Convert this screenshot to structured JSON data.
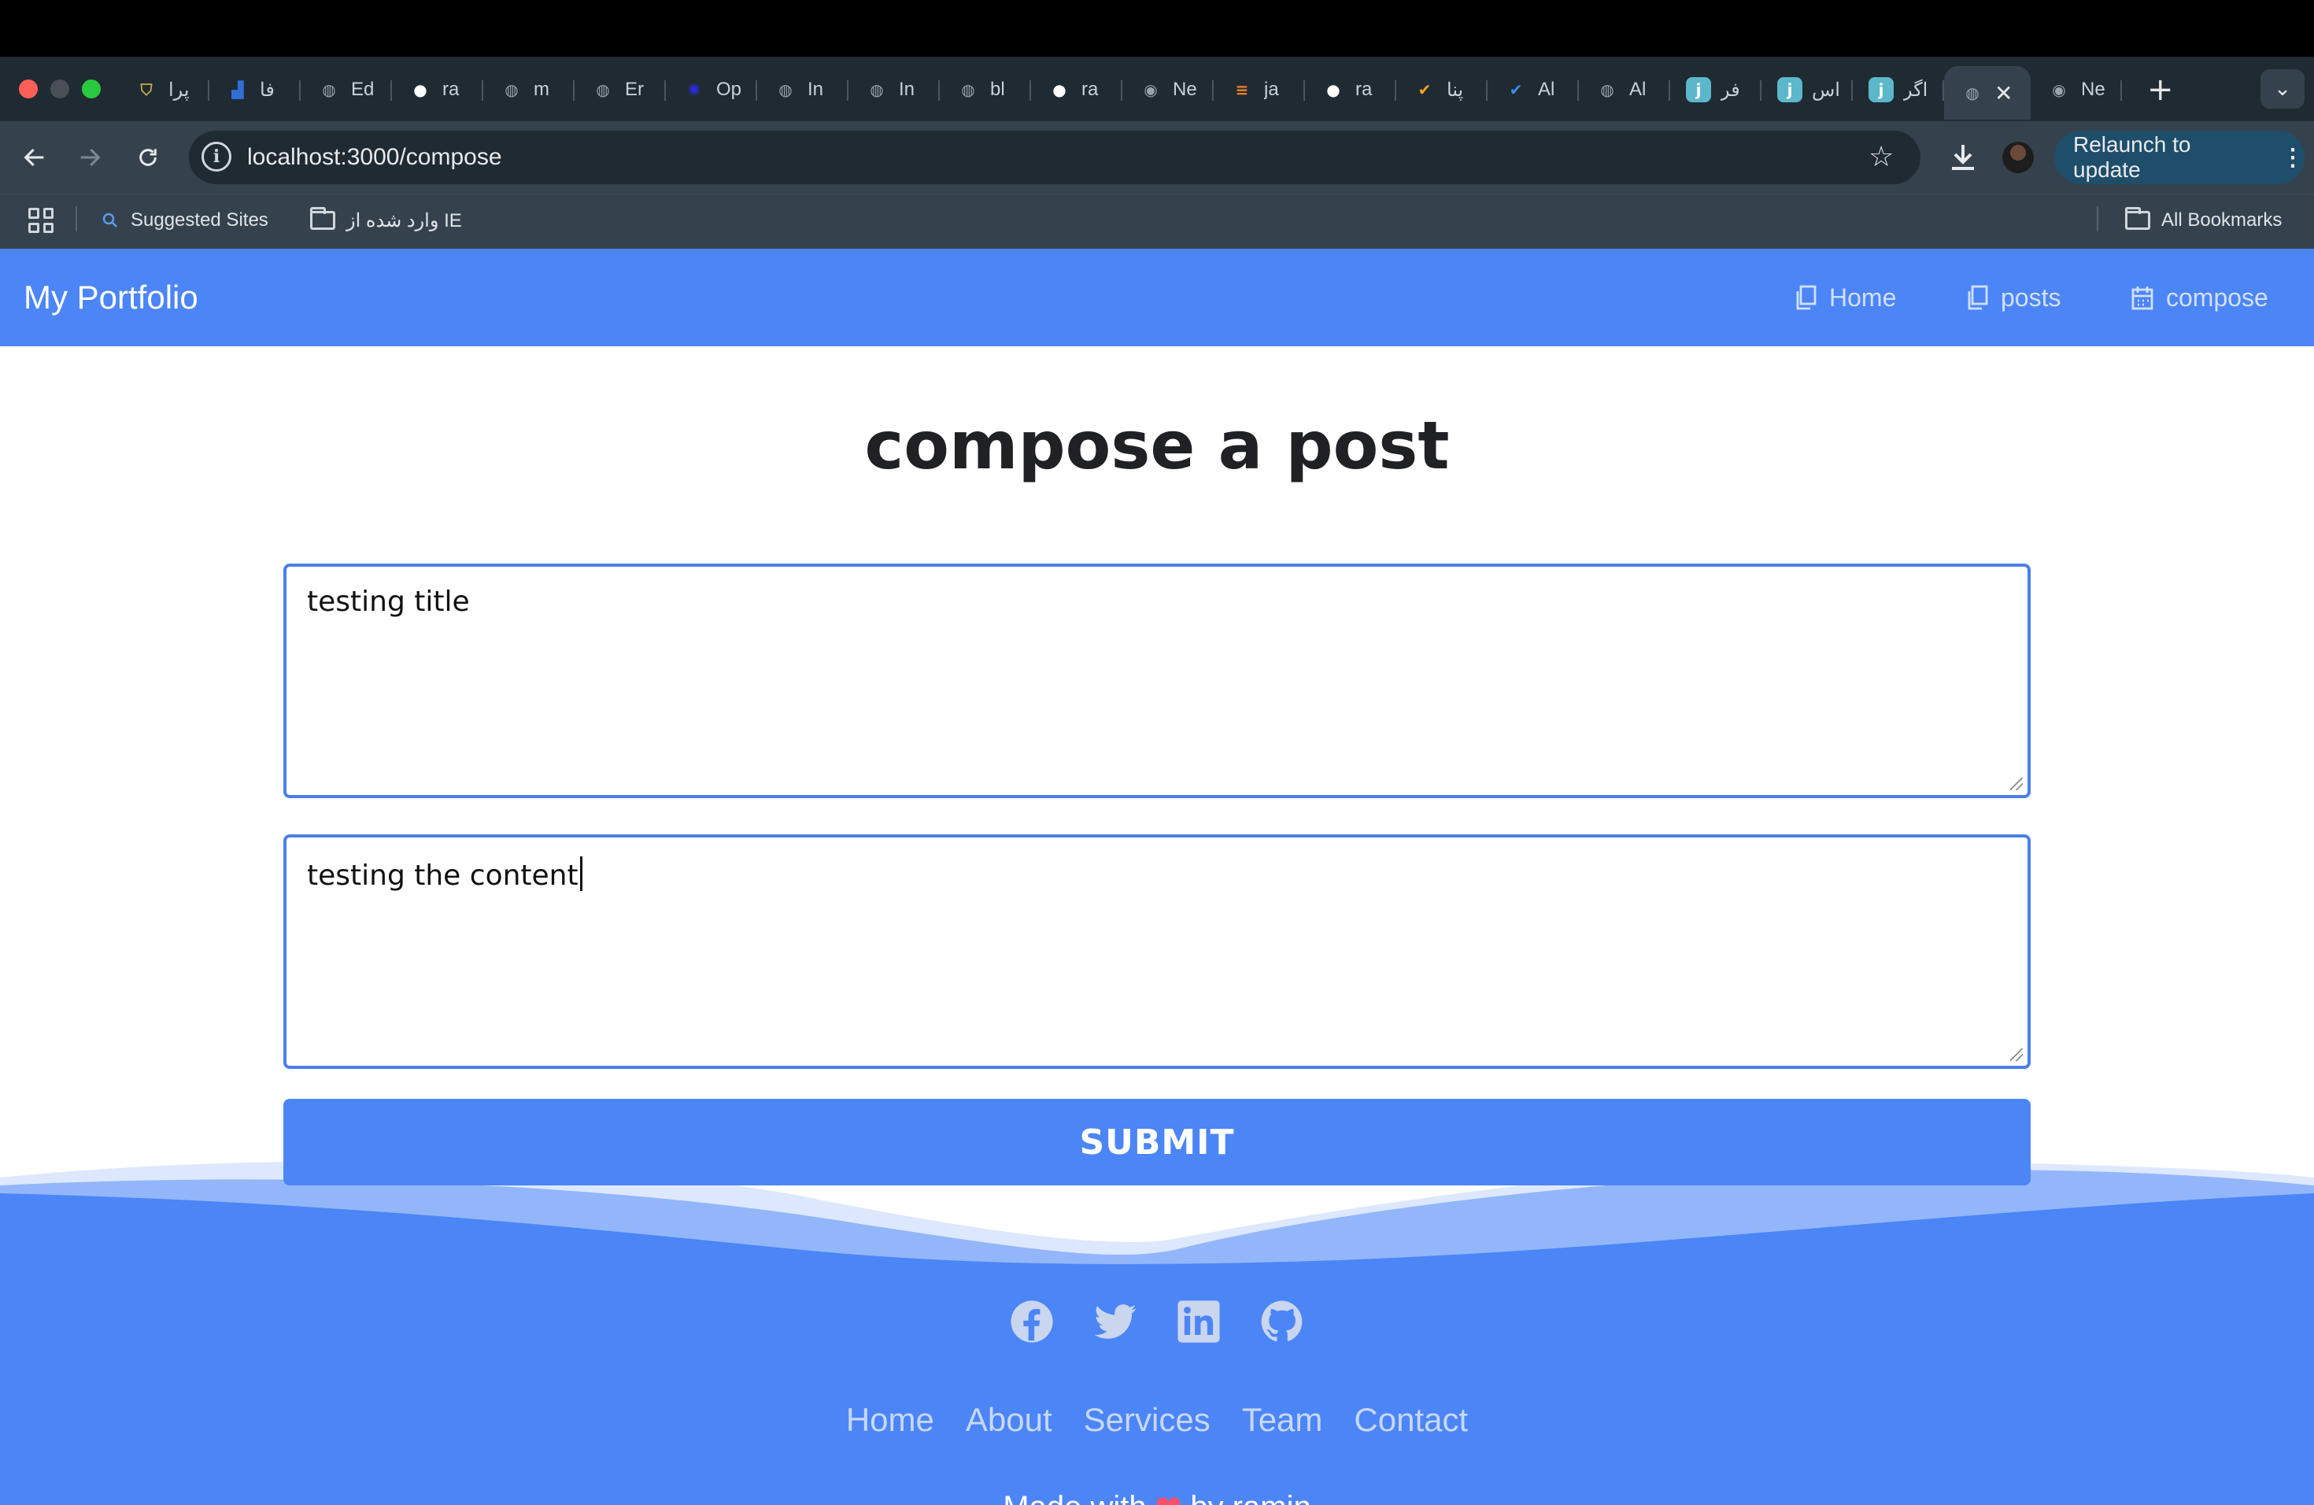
{
  "browser": {
    "tabs": [
      {
        "icon": "shield-icon",
        "label": "پرا",
        "color": "#c4a94a"
      },
      {
        "icon": "factory-icon",
        "label": "فا",
        "color": "#2f6fd6"
      },
      {
        "icon": "globe-icon",
        "label": "Ed",
        "color": "#9aa4ad"
      },
      {
        "icon": "github-icon",
        "label": "ra",
        "color": "#ffffff"
      },
      {
        "icon": "globe-icon",
        "label": "m",
        "color": "#9aa4ad"
      },
      {
        "icon": "globe-icon",
        "label": "Er",
        "color": "#9aa4ad"
      },
      {
        "icon": "openai-icon",
        "label": "Op",
        "color": "#2b2bd6"
      },
      {
        "icon": "globe-icon",
        "label": "In",
        "color": "#9aa4ad"
      },
      {
        "icon": "globe-icon",
        "label": "In",
        "color": "#9aa4ad"
      },
      {
        "icon": "globe-icon",
        "label": "bl",
        "color": "#9aa4ad"
      },
      {
        "icon": "github-icon",
        "label": "ra",
        "color": "#ffffff"
      },
      {
        "icon": "chrome-icon",
        "label": "Ne",
        "color": "#9aa4ad"
      },
      {
        "icon": "stackoverflow-icon",
        "label": "ja",
        "color": "#f48024"
      },
      {
        "icon": "github-icon",
        "label": "ra",
        "color": "#ffffff"
      },
      {
        "icon": "check-badge-icon",
        "label": "پنا",
        "color": "#f5a623"
      },
      {
        "icon": "check-badge-icon",
        "label": "Al",
        "color": "#3b8ef0"
      },
      {
        "icon": "globe-icon",
        "label": "Al",
        "color": "#9aa4ad"
      },
      {
        "icon": "j-icon",
        "label": "فر",
        "color": "#5bb7c9"
      },
      {
        "icon": "j-icon",
        "label": "اس",
        "color": "#5bb7c9"
      },
      {
        "icon": "j-icon",
        "label": "اگر",
        "color": "#5bb7c9"
      }
    ],
    "active_tab_close": "✕",
    "last_tab": {
      "icon": "chrome-icon",
      "label": "Ne"
    },
    "new_tab": "+",
    "overflow": "⌄",
    "url": "localhost:3000/compose",
    "relaunch_label": "Relaunch to update",
    "bookmarks": {
      "suggested": "Suggested Sites",
      "imported": "وارد شده از IE",
      "all": "All Bookmarks"
    }
  },
  "navbar": {
    "brand": "My Portfolio",
    "links": [
      {
        "label": "Home",
        "icon": "copy-icon"
      },
      {
        "label": "posts",
        "icon": "copy-icon"
      },
      {
        "label": "compose",
        "icon": "calendar-icon"
      }
    ]
  },
  "main": {
    "title": "compose a post",
    "title_field_value": "testing title",
    "content_field_value": "testing the content",
    "submit_label": "SUBMIT"
  },
  "footer": {
    "social": [
      "facebook-icon",
      "twitter-icon",
      "linkedin-icon",
      "github-icon"
    ],
    "links": [
      "Home",
      "About",
      "Services",
      "Team",
      "Contact"
    ],
    "made_with_prefix": "Made with",
    "made_with_heart": "❤",
    "made_with_suffix": "by ramin"
  },
  "colors": {
    "accent": "#4c85f6",
    "field_border": "#4a7fe8",
    "chrome_bg": "#35424d"
  }
}
